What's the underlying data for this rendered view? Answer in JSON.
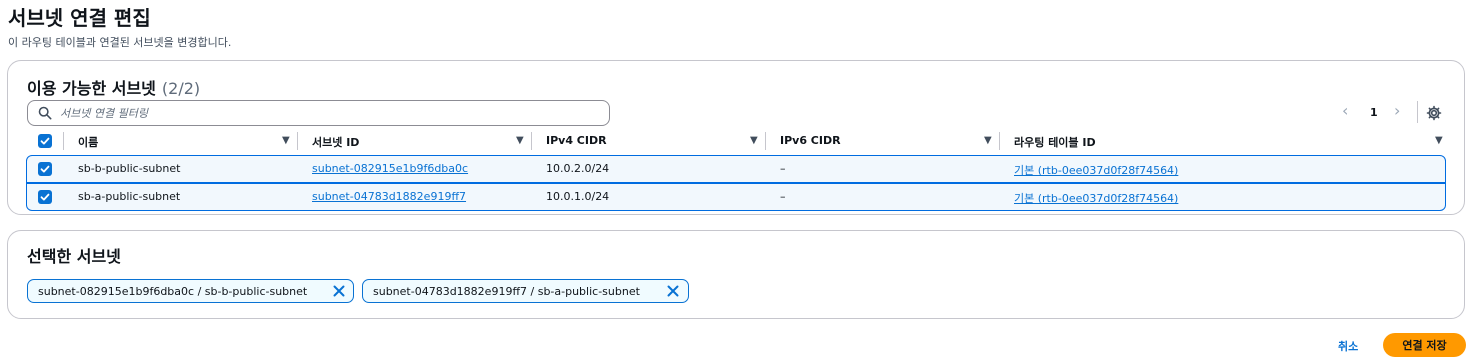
{
  "page": {
    "title": "서브넷 연결 편집",
    "description": "이 라우팅 테이블과 연결된 서브넷을 변경합니다."
  },
  "available": {
    "title": "이용 가능한 서브넷",
    "count": "(2/2)",
    "search_placeholder": "서브넷 연결 필터링",
    "pagination": {
      "prev": "‹",
      "page": "1",
      "next": "›"
    },
    "columns": [
      "이름",
      "서브넷 ID",
      "IPv4 CIDR",
      "IPv6 CIDR",
      "라우팅 테이블 ID"
    ],
    "rows": [
      {
        "name": "sb-b-public-subnet",
        "subnet_id": "subnet-082915e1b9f6dba0c",
        "ipv4": "10.0.2.0/24",
        "ipv6": "–",
        "route_table": "기본 (rtb-0ee037d0f28f74564)"
      },
      {
        "name": "sb-a-public-subnet",
        "subnet_id": "subnet-04783d1882e919ff7",
        "ipv4": "10.0.1.0/24",
        "ipv6": "–",
        "route_table": "기본 (rtb-0ee037d0f28f74564)"
      }
    ]
  },
  "selected": {
    "title": "선택한 서브넷",
    "tokens": [
      "subnet-082915e1b9f6dba0c / sb-b-public-subnet",
      "subnet-04783d1882e919ff7 / sb-a-public-subnet"
    ]
  },
  "actions": {
    "cancel": "취소",
    "save": "연결 저장"
  },
  "colors": {
    "accent": "#0972d3",
    "primary_button": "#ff9900",
    "row_selected_bg": "#f2f8fd"
  }
}
